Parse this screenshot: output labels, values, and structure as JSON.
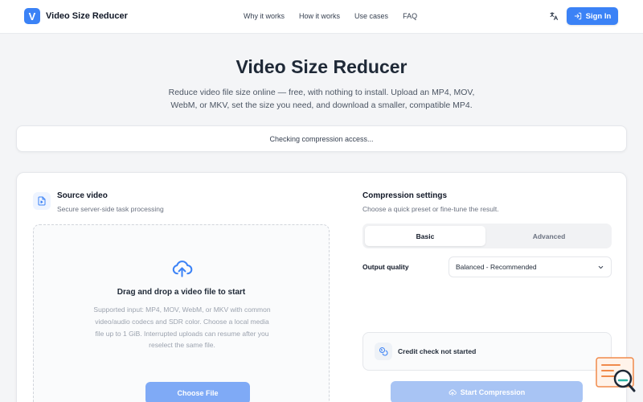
{
  "brand": {
    "logo_letter": "V",
    "name": "Video Size Reducer"
  },
  "nav": {
    "links": [
      "Why it works",
      "How it works",
      "Use cases",
      "FAQ"
    ],
    "sign_in": "Sign In"
  },
  "hero": {
    "title": "Video Size Reducer",
    "subtitle": "Reduce video file size online — free, with nothing to install. Upload an MP4, MOV, WebM, or MKV, set the size you need, and download a smaller, compatible MP4."
  },
  "status": {
    "text": "Checking compression access..."
  },
  "source": {
    "title": "Source video",
    "subtitle": "Secure server-side task processing",
    "drop_title": "Drag and drop a video file to start",
    "drop_text": "Supported input: MP4, MOV, WebM, or MKV with common video/audio codecs and SDR color. Choose a local media file up to 1 GiB. Interrupted uploads can resume after you reselect the same file.",
    "choose_button": "Choose File"
  },
  "settings": {
    "title": "Compression settings",
    "subtitle": "Choose a quick preset or fine-tune the result.",
    "tabs": [
      {
        "label": "Basic",
        "active": true
      },
      {
        "label": "Advanced",
        "active": false
      }
    ],
    "quality_label": "Output quality",
    "quality_value": "Balanced - Recommended",
    "credit_text": "Credit check not started",
    "start_button": "Start Compression"
  },
  "colors": {
    "accent": "#3b82f6",
    "disabled_button": "#a8c4f4",
    "page_bg": "#f4f5f7"
  },
  "icons": {
    "brand": "v-logo",
    "translate": "translate-icon",
    "sign_in": "login-icon",
    "source": "video-file-icon",
    "upload": "cloud-upload-icon",
    "select": "chevron-down-icon",
    "credit": "coins-icon",
    "start": "cloud-upload-icon",
    "widget": "search-chat-icon"
  }
}
